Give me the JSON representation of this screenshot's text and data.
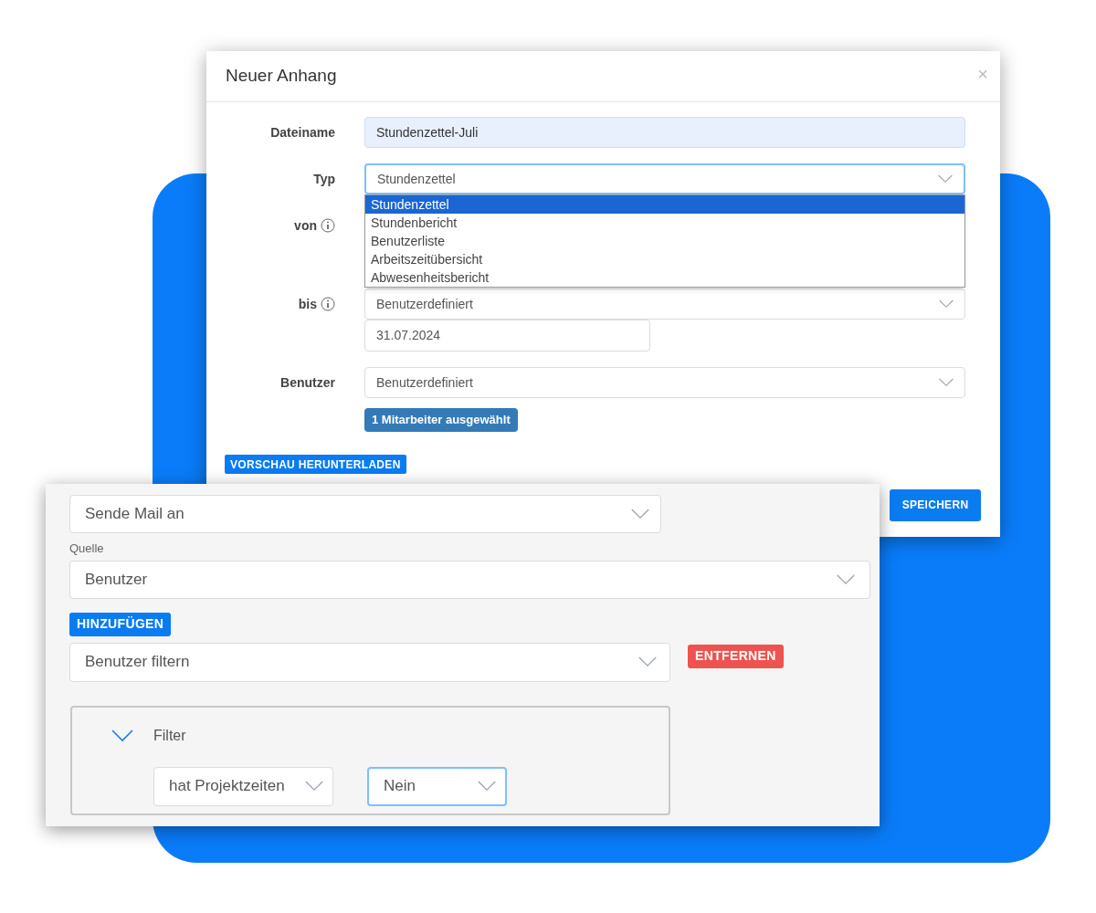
{
  "dialog": {
    "title": "Neuer Anhang",
    "close": "×",
    "fields": [
      {
        "kind": "text",
        "label": "Dateiname",
        "value": "Stundenzettel-Juli",
        "info": false
      },
      {
        "kind": "select",
        "label": "Typ",
        "value": "Stundenzettel",
        "focused": true,
        "info": false,
        "expanded": true,
        "options": [
          {
            "label": "Stundenzettel",
            "selected": true
          },
          {
            "label": "Stundenbericht",
            "selected": false
          },
          {
            "label": "Benutzerliste",
            "selected": false
          },
          {
            "label": "Arbeitszeitübersicht",
            "selected": false
          },
          {
            "label": "Abwesenheitsbericht",
            "selected": false
          }
        ]
      },
      {
        "kind": "covered",
        "label": "von",
        "info": true
      },
      {
        "kind": "select_date",
        "label": "bis",
        "info": true,
        "value": "Benutzerdefiniert",
        "date": "31.07.2024",
        "focused": false
      },
      {
        "kind": "select",
        "label": "Benutzer",
        "value": "Benutzerdefiniert",
        "focused": false,
        "info": false,
        "badge": "1 Mitarbeiter ausgewählt"
      }
    ],
    "preview_button": "VORSCHAU HERUNTERLADEN",
    "save_button": "SPEICHERN"
  },
  "panel": {
    "action_select": "Sende Mail an",
    "source_label": "Quelle",
    "source_select": "Benutzer",
    "add_button": "HINZUFÜGEN",
    "filter_select": "Benutzer filtern",
    "remove_button": "ENTFERNEN",
    "filter_group": {
      "title": "Filter",
      "expanded": true,
      "conditions": [
        {
          "value": "hat Projektzeiten",
          "focused": false
        },
        {
          "value": "Nein",
          "focused": true
        }
      ]
    }
  }
}
